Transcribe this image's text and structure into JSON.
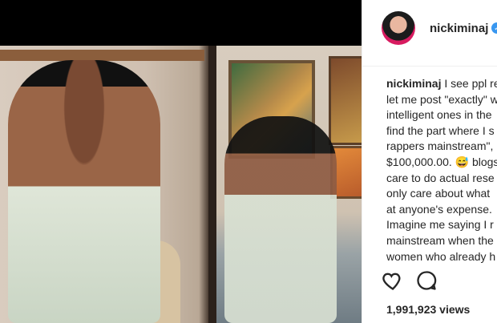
{
  "post": {
    "username": "nickiminaj",
    "caption_lines": [
      "I see ppl re",
      "let me post \"exactly\" w",
      "intelligent ones in the",
      "find the part where I s",
      "rappers mainstream\",",
      "$100,000.00. 😅 blogs",
      "care to do actual rese",
      "only care about what",
      "at anyone's expense.",
      "Imagine me saying I r",
      "mainstream when the",
      "women who already h"
    ],
    "views": "1,991,923 views"
  },
  "icons": {
    "verified": "verified-badge-icon",
    "like": "heart-icon",
    "comment": "comment-icon"
  },
  "colors": {
    "text": "#262626",
    "verified": "#3897f0"
  }
}
